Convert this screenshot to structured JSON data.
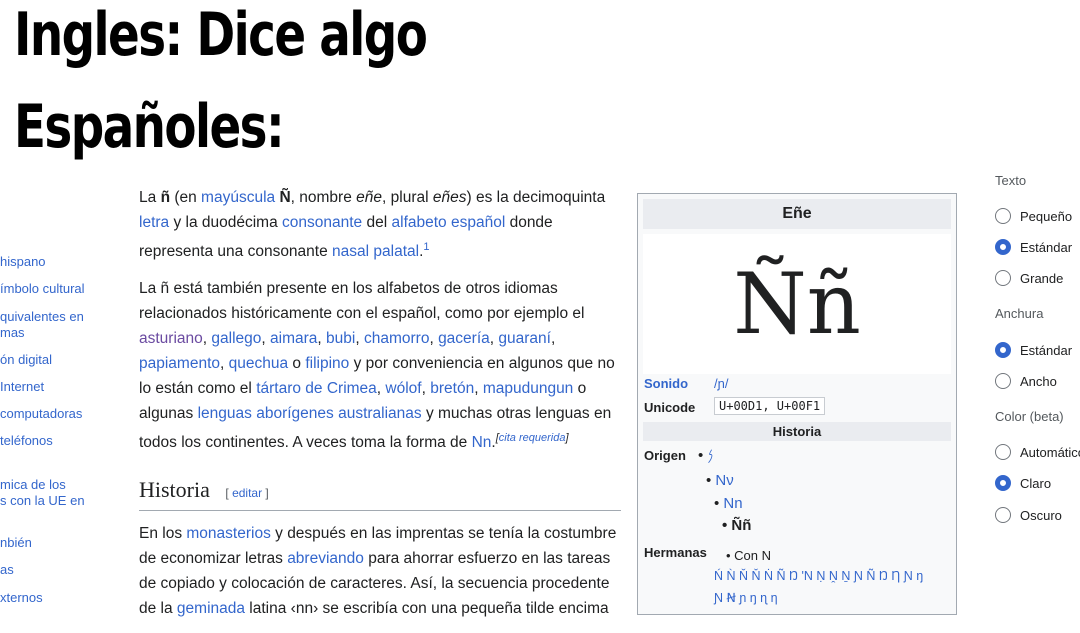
{
  "meme": {
    "line1": "Ingles: Dice algo",
    "line2": "Españoles:"
  },
  "sidebar": {
    "items": [
      "hispano",
      "ímbolo cultural",
      "quivalentes en",
      "mas",
      "ón digital",
      "Internet",
      "computadoras",
      "teléfonos",
      "mica de los",
      "s con la UE en",
      "nbién",
      "as",
      "xternos"
    ]
  },
  "article": {
    "p1_a": "La ",
    "p1_b": "ñ",
    "p1_c": " (en ",
    "p1_d": "mayúscula",
    "p1_e": " ",
    "p1_f": "Ñ",
    "p1_g": ", nombre ",
    "p1_h": "eñe",
    "p1_i": ", plural ",
    "p1_j": "eñes",
    "p1_k": ") es la decimoquinta ",
    "p1_l": "letra",
    "p1_m": " y la duodécima ",
    "p1_n": "consonante",
    "p1_o": " del ",
    "p1_p": "alfabeto español",
    "p1_q": " donde representa una consonante ",
    "p1_r": "nasal palatal",
    "p1_sup": "1",
    "p2_a": "La ñ está también presente en los alfabetos de otros idiomas relacionados históricamente con el español, como por ejemplo el ",
    "l_asturiano": "asturiano",
    "l_gallego": "gallego",
    "l_aimara": "aimara",
    "l_bubi": "bubi",
    "l_chamorro": "chamorro",
    "l_gaceria": "gacería",
    "l_guarani": "guaraní",
    "l_papiamento": "papiamento",
    "l_quechua": "quechua",
    "t_o": " o ",
    "l_filipino": "filipino",
    "p2_b": " y por conveniencia en algunos que no lo están como el ",
    "l_tartaro": "tártaro de Crimea",
    "l_wolof": "wólof",
    "l_breton": "bretón",
    "l_mapudungun": "mapudungun",
    "p2_c": " y muchas otras lenguas en todos los continentes. A veces toma la forma de ",
    "l_australianas": "lenguas aborígenes australianas",
    "l_nn": "Nn",
    "cite": "cita requerida",
    "h2": "Historia",
    "edit": "editar",
    "p3_a": "En los ",
    "l_monasterios": "monasterios",
    "p3_b": " y después en las imprentas se tenía la costumbre de economizar letras ",
    "l_abreviando": "abreviando",
    "p3_c": " para ahorrar esfuerzo en las tareas de copiado y colocación de caracteres. Así, la secuencia procedente de la ",
    "l_geminada": "geminada",
    "p3_d": " latina ‹nn› se escribía con una pequeña tilde encima"
  },
  "infobox": {
    "title": "Eñe",
    "glyph": "Ññ",
    "sonido_label": "Sonido",
    "sonido_value": "/ɲ/",
    "unicode_label": "Unicode",
    "unicode_value": "U+00D1, U+00F1",
    "historia": "Historia",
    "origen_label": "Origen",
    "origen": [
      "𐤍",
      "Nν",
      "Nn",
      "Ññ"
    ],
    "hermanas_label": "Hermanas",
    "con_n": "Con N",
    "hermanas_row1": "Ń Ǹ Ň Ň Ṅ Ñ Ŋ 'N Ṇ Ṋ Ṉ Ɲ Ñ Ŋ Ƞ Ɲ ŋ",
    "hermanas_row2": "Ɲ Ꞥ ɲ ŋ ɳ ƞ"
  },
  "settings": {
    "texto": "Texto",
    "pequeno": "Pequeño",
    "estandar": "Estándar",
    "grande": "Grande",
    "anchura": "Anchura",
    "estandar2": "Estándar",
    "ancho": "Ancho",
    "color": "Color (beta)",
    "automatico": "Automático",
    "claro": "Claro",
    "oscuro": "Oscuro"
  },
  "colors": {
    "link": "#3366cc",
    "visited": "#6b4ba1",
    "radio_selected": "#3366cc"
  }
}
